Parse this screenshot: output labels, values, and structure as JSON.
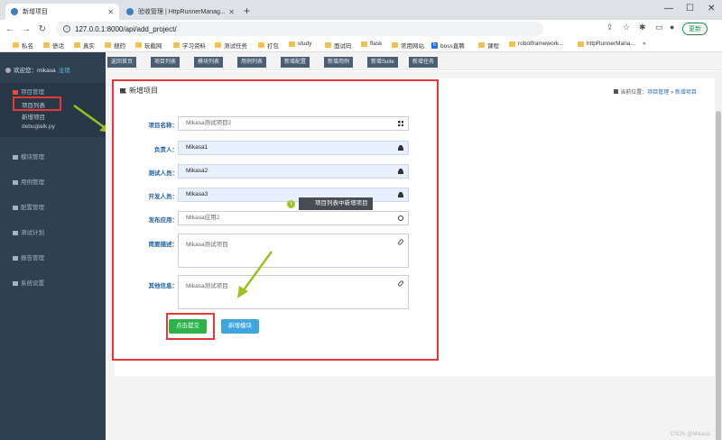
{
  "browser": {
    "tabs": [
      {
        "title": "新增项目",
        "active": true
      },
      {
        "title": "验收管理 | HttpRunnerManag...",
        "active": false
      }
    ],
    "url": "127.0.0.1:8000/api/add_project/",
    "update_label": "更新",
    "bookmarks": [
      "私名",
      "债话",
      "真实",
      "搜药",
      "玩截网",
      "学习资料",
      "测试任务",
      "打包",
      "study",
      "面试码",
      "flask",
      "常用网站",
      "boss直聘",
      "课程",
      "robotframework...",
      "httpRunnerMana..."
    ]
  },
  "sidebar": {
    "welcome": "欢迎您：mikasa",
    "logout": "注销",
    "menus": [
      {
        "label": "项目管理",
        "children": [
          "项目列表",
          "新增项目",
          "debugtalk.py"
        ]
      },
      {
        "label": "模块管理"
      },
      {
        "label": "用例管理"
      },
      {
        "label": "配置管理"
      },
      {
        "label": "测试计划"
      },
      {
        "label": "报告管理"
      },
      {
        "label": "系统设置"
      }
    ]
  },
  "topnav": [
    "返回首页",
    "项目列表",
    "模块列表",
    "用例列表",
    "新增配置",
    "新增用例",
    "新增Suite",
    "新增任务"
  ],
  "page": {
    "title": "新增项目",
    "breadcrumb_prefix": "当前位置：",
    "breadcrumb": [
      "项目管理",
      "新增项目"
    ],
    "fields": [
      {
        "label": "项目名称：",
        "value": "Mikasa测试项目2",
        "filled": false,
        "icon": "grid-icon"
      },
      {
        "label": "负责人：",
        "value": "Mikasa1",
        "filled": true,
        "icon": "person-icon"
      },
      {
        "label": "测试人员：",
        "value": "Mikasa2",
        "filled": true,
        "icon": "person-icon"
      },
      {
        "label": "开发人员：",
        "value": "Mikasa3",
        "filled": true,
        "icon": "person-icon"
      },
      {
        "label": "发布应用：",
        "value": "Mikasa应用2",
        "filled": false,
        "icon": "globe-icon"
      }
    ],
    "textareas": [
      {
        "label": "简要描述：",
        "value": "Mikasa测试项目"
      },
      {
        "label": "其他信息：",
        "value": "Mikasa测试项目"
      }
    ],
    "submit_label": "点击提交",
    "add_module_label": "新增模块",
    "tooltip": "项目列表中新增项目",
    "tooltip_num": "1"
  },
  "watermark": "CSDN @Mikasa."
}
